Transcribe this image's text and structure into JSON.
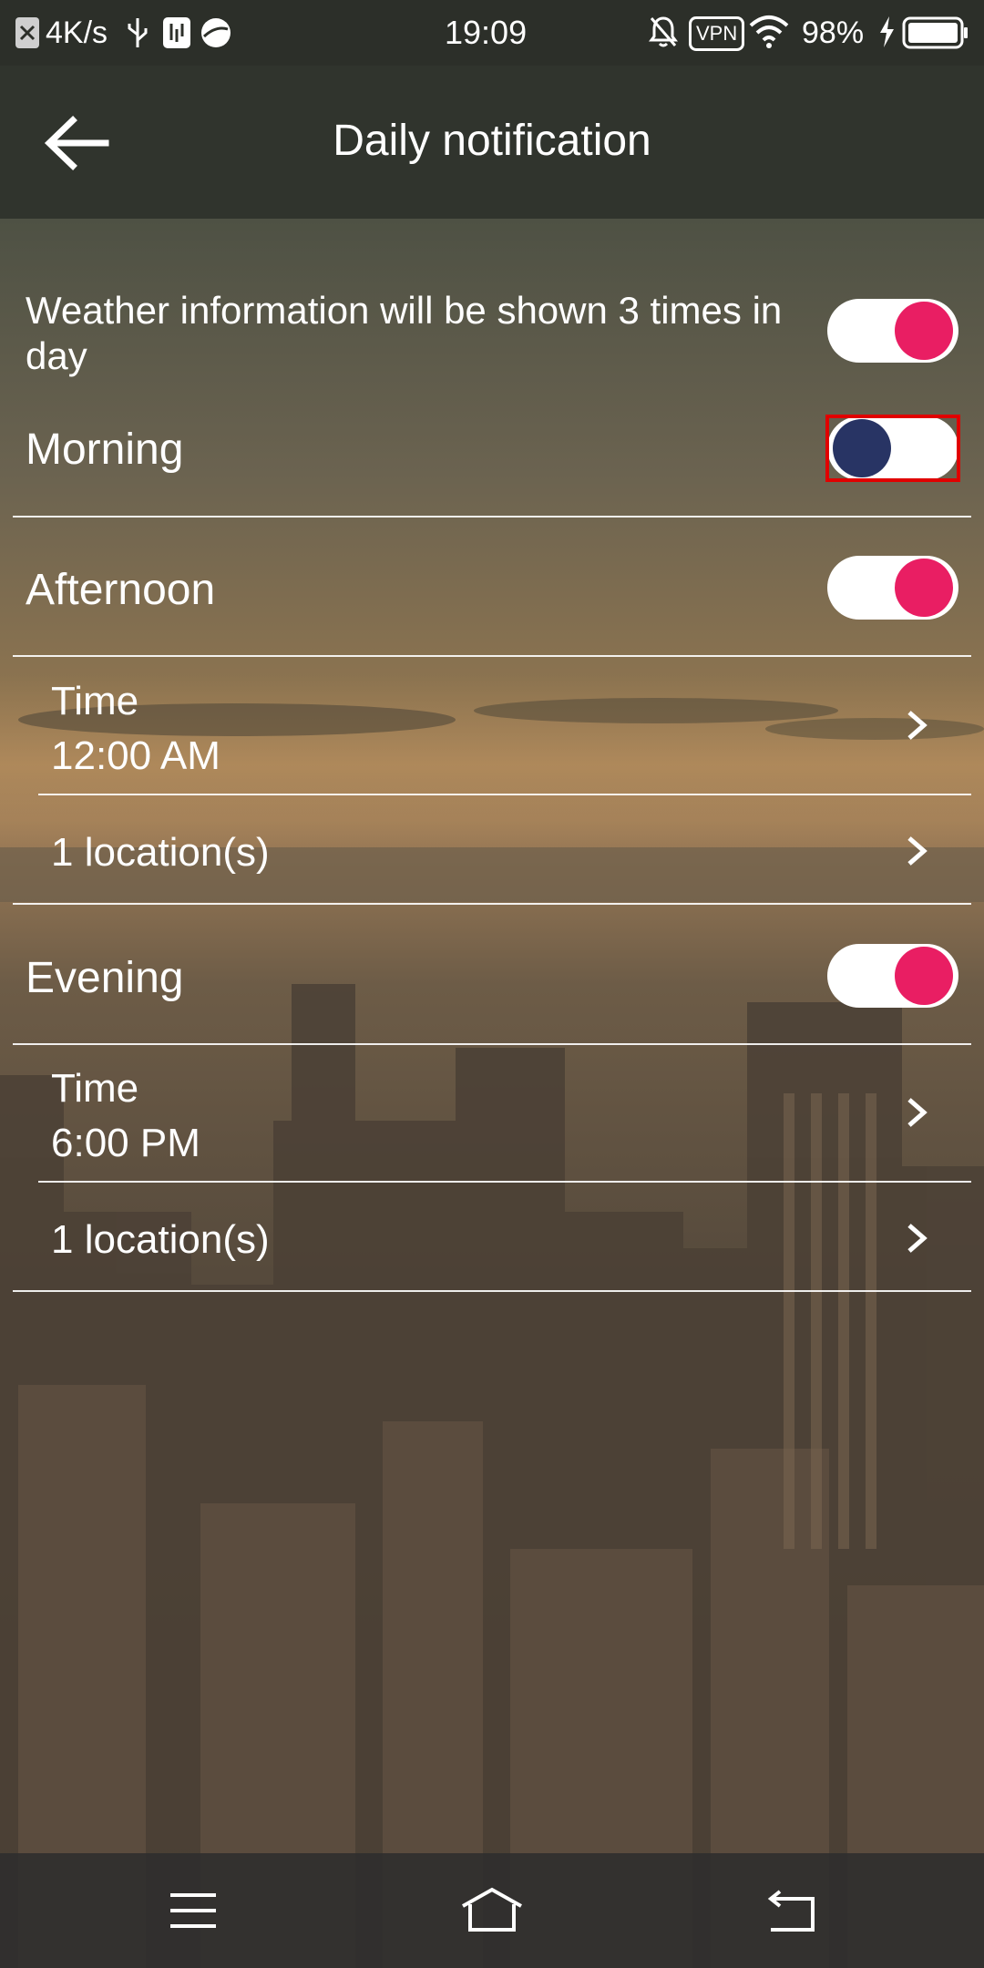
{
  "status_bar": {
    "speed": "4K/s",
    "time": "19:09",
    "vpn": "VPN",
    "battery": "98%"
  },
  "toolbar": {
    "title": "Daily notification",
    "back_icon": "arrow-left-icon"
  },
  "master": {
    "description": "Weather information will be shown 3 times in day",
    "enabled": true
  },
  "sections": {
    "morning": {
      "label": "Morning",
      "enabled": false
    },
    "afternoon": {
      "label": "Afternoon",
      "enabled": true,
      "time_label": "Time",
      "time_value": "12:00 AM",
      "locations": "1 location(s)"
    },
    "evening": {
      "label": "Evening",
      "enabled": true,
      "time_label": "Time",
      "time_value": "6:00 PM",
      "locations": "1 location(s)"
    }
  },
  "colors": {
    "toggle_on": "#e91e63",
    "toggle_off_knob": "#283464",
    "highlight": "#e00000"
  },
  "nav_bar": {
    "menu_icon": "menu-icon",
    "home_icon": "home-icon",
    "back_icon": "back-icon"
  }
}
